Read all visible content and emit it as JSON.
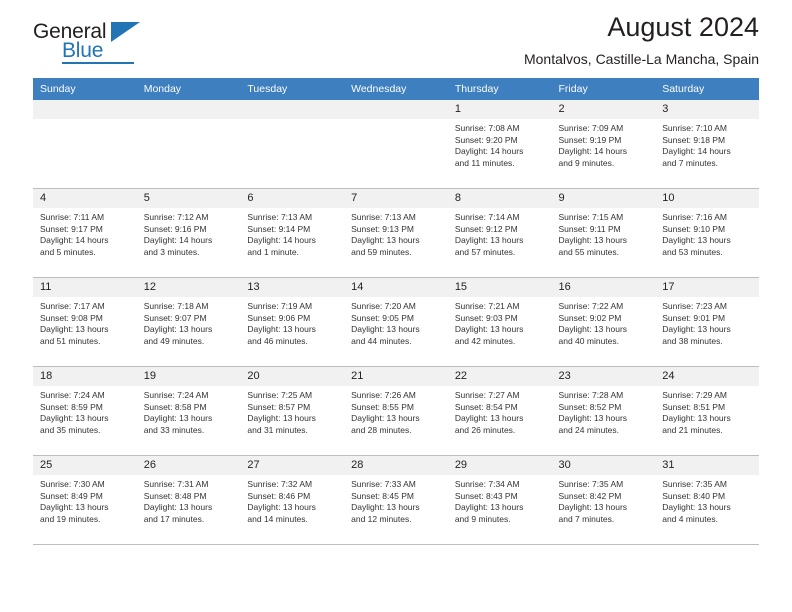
{
  "brand": {
    "name_top": "General",
    "name_bottom": "Blue",
    "triangle_icon": "triangle-icon",
    "accent_color": "#2275b5"
  },
  "header": {
    "title": "August 2024",
    "subtitle": "Montalvos, Castille-La Mancha, Spain"
  },
  "theme": {
    "header_row_bg": "#3d7fbf",
    "day_number_bg": "#f1f1f1",
    "grid_line": "#bdbdbd",
    "text": "#231f20"
  },
  "weekdays": [
    "Sunday",
    "Monday",
    "Tuesday",
    "Wednesday",
    "Thursday",
    "Friday",
    "Saturday"
  ],
  "labels": {
    "sunrise_prefix": "Sunrise:",
    "sunset_prefix": "Sunset:",
    "daylight_prefix": "Daylight:"
  },
  "weeks": [
    [
      {
        "day": "",
        "sunrise": "",
        "sunset": "",
        "daylight1": "",
        "daylight2": ""
      },
      {
        "day": "",
        "sunrise": "",
        "sunset": "",
        "daylight1": "",
        "daylight2": ""
      },
      {
        "day": "",
        "sunrise": "",
        "sunset": "",
        "daylight1": "",
        "daylight2": ""
      },
      {
        "day": "",
        "sunrise": "",
        "sunset": "",
        "daylight1": "",
        "daylight2": ""
      },
      {
        "day": "1",
        "sunrise": "Sunrise: 7:08 AM",
        "sunset": "Sunset: 9:20 PM",
        "daylight1": "Daylight: 14 hours",
        "daylight2": "and 11 minutes."
      },
      {
        "day": "2",
        "sunrise": "Sunrise: 7:09 AM",
        "sunset": "Sunset: 9:19 PM",
        "daylight1": "Daylight: 14 hours",
        "daylight2": "and 9 minutes."
      },
      {
        "day": "3",
        "sunrise": "Sunrise: 7:10 AM",
        "sunset": "Sunset: 9:18 PM",
        "daylight1": "Daylight: 14 hours",
        "daylight2": "and 7 minutes."
      }
    ],
    [
      {
        "day": "4",
        "sunrise": "Sunrise: 7:11 AM",
        "sunset": "Sunset: 9:17 PM",
        "daylight1": "Daylight: 14 hours",
        "daylight2": "and 5 minutes."
      },
      {
        "day": "5",
        "sunrise": "Sunrise: 7:12 AM",
        "sunset": "Sunset: 9:16 PM",
        "daylight1": "Daylight: 14 hours",
        "daylight2": "and 3 minutes."
      },
      {
        "day": "6",
        "sunrise": "Sunrise: 7:13 AM",
        "sunset": "Sunset: 9:14 PM",
        "daylight1": "Daylight: 14 hours",
        "daylight2": "and 1 minute."
      },
      {
        "day": "7",
        "sunrise": "Sunrise: 7:13 AM",
        "sunset": "Sunset: 9:13 PM",
        "daylight1": "Daylight: 13 hours",
        "daylight2": "and 59 minutes."
      },
      {
        "day": "8",
        "sunrise": "Sunrise: 7:14 AM",
        "sunset": "Sunset: 9:12 PM",
        "daylight1": "Daylight: 13 hours",
        "daylight2": "and 57 minutes."
      },
      {
        "day": "9",
        "sunrise": "Sunrise: 7:15 AM",
        "sunset": "Sunset: 9:11 PM",
        "daylight1": "Daylight: 13 hours",
        "daylight2": "and 55 minutes."
      },
      {
        "day": "10",
        "sunrise": "Sunrise: 7:16 AM",
        "sunset": "Sunset: 9:10 PM",
        "daylight1": "Daylight: 13 hours",
        "daylight2": "and 53 minutes."
      }
    ],
    [
      {
        "day": "11",
        "sunrise": "Sunrise: 7:17 AM",
        "sunset": "Sunset: 9:08 PM",
        "daylight1": "Daylight: 13 hours",
        "daylight2": "and 51 minutes."
      },
      {
        "day": "12",
        "sunrise": "Sunrise: 7:18 AM",
        "sunset": "Sunset: 9:07 PM",
        "daylight1": "Daylight: 13 hours",
        "daylight2": "and 49 minutes."
      },
      {
        "day": "13",
        "sunrise": "Sunrise: 7:19 AM",
        "sunset": "Sunset: 9:06 PM",
        "daylight1": "Daylight: 13 hours",
        "daylight2": "and 46 minutes."
      },
      {
        "day": "14",
        "sunrise": "Sunrise: 7:20 AM",
        "sunset": "Sunset: 9:05 PM",
        "daylight1": "Daylight: 13 hours",
        "daylight2": "and 44 minutes."
      },
      {
        "day": "15",
        "sunrise": "Sunrise: 7:21 AM",
        "sunset": "Sunset: 9:03 PM",
        "daylight1": "Daylight: 13 hours",
        "daylight2": "and 42 minutes."
      },
      {
        "day": "16",
        "sunrise": "Sunrise: 7:22 AM",
        "sunset": "Sunset: 9:02 PM",
        "daylight1": "Daylight: 13 hours",
        "daylight2": "and 40 minutes."
      },
      {
        "day": "17",
        "sunrise": "Sunrise: 7:23 AM",
        "sunset": "Sunset: 9:01 PM",
        "daylight1": "Daylight: 13 hours",
        "daylight2": "and 38 minutes."
      }
    ],
    [
      {
        "day": "18",
        "sunrise": "Sunrise: 7:24 AM",
        "sunset": "Sunset: 8:59 PM",
        "daylight1": "Daylight: 13 hours",
        "daylight2": "and 35 minutes."
      },
      {
        "day": "19",
        "sunrise": "Sunrise: 7:24 AM",
        "sunset": "Sunset: 8:58 PM",
        "daylight1": "Daylight: 13 hours",
        "daylight2": "and 33 minutes."
      },
      {
        "day": "20",
        "sunrise": "Sunrise: 7:25 AM",
        "sunset": "Sunset: 8:57 PM",
        "daylight1": "Daylight: 13 hours",
        "daylight2": "and 31 minutes."
      },
      {
        "day": "21",
        "sunrise": "Sunrise: 7:26 AM",
        "sunset": "Sunset: 8:55 PM",
        "daylight1": "Daylight: 13 hours",
        "daylight2": "and 28 minutes."
      },
      {
        "day": "22",
        "sunrise": "Sunrise: 7:27 AM",
        "sunset": "Sunset: 8:54 PM",
        "daylight1": "Daylight: 13 hours",
        "daylight2": "and 26 minutes."
      },
      {
        "day": "23",
        "sunrise": "Sunrise: 7:28 AM",
        "sunset": "Sunset: 8:52 PM",
        "daylight1": "Daylight: 13 hours",
        "daylight2": "and 24 minutes."
      },
      {
        "day": "24",
        "sunrise": "Sunrise: 7:29 AM",
        "sunset": "Sunset: 8:51 PM",
        "daylight1": "Daylight: 13 hours",
        "daylight2": "and 21 minutes."
      }
    ],
    [
      {
        "day": "25",
        "sunrise": "Sunrise: 7:30 AM",
        "sunset": "Sunset: 8:49 PM",
        "daylight1": "Daylight: 13 hours",
        "daylight2": "and 19 minutes."
      },
      {
        "day": "26",
        "sunrise": "Sunrise: 7:31 AM",
        "sunset": "Sunset: 8:48 PM",
        "daylight1": "Daylight: 13 hours",
        "daylight2": "and 17 minutes."
      },
      {
        "day": "27",
        "sunrise": "Sunrise: 7:32 AM",
        "sunset": "Sunset: 8:46 PM",
        "daylight1": "Daylight: 13 hours",
        "daylight2": "and 14 minutes."
      },
      {
        "day": "28",
        "sunrise": "Sunrise: 7:33 AM",
        "sunset": "Sunset: 8:45 PM",
        "daylight1": "Daylight: 13 hours",
        "daylight2": "and 12 minutes."
      },
      {
        "day": "29",
        "sunrise": "Sunrise: 7:34 AM",
        "sunset": "Sunset: 8:43 PM",
        "daylight1": "Daylight: 13 hours",
        "daylight2": "and 9 minutes."
      },
      {
        "day": "30",
        "sunrise": "Sunrise: 7:35 AM",
        "sunset": "Sunset: 8:42 PM",
        "daylight1": "Daylight: 13 hours",
        "daylight2": "and 7 minutes."
      },
      {
        "day": "31",
        "sunrise": "Sunrise: 7:35 AM",
        "sunset": "Sunset: 8:40 PM",
        "daylight1": "Daylight: 13 hours",
        "daylight2": "and 4 minutes."
      }
    ]
  ]
}
